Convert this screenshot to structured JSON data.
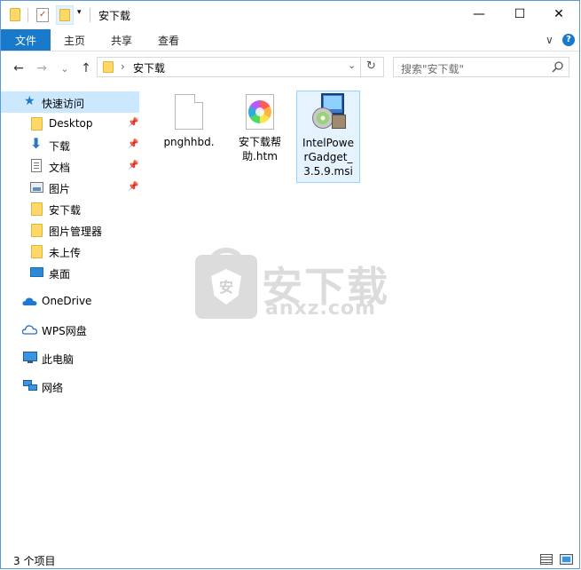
{
  "window": {
    "title": "安下载",
    "minimize": "—",
    "maximize": "☐",
    "close": "✕"
  },
  "ribbon": {
    "file_tab": "文件",
    "tabs": [
      "主页",
      "共享",
      "查看"
    ],
    "expand": "∨",
    "help": "?"
  },
  "nav": {
    "back": "←",
    "forward": "→",
    "recent": "⌄",
    "up": "↑"
  },
  "address": {
    "separator": "›",
    "path": "安下载",
    "dropdown": "⌄",
    "refresh": "↻"
  },
  "search": {
    "placeholder": "搜索\"安下载\""
  },
  "sidebar": {
    "quick_access": "快速访问",
    "items": [
      {
        "label": "Desktop",
        "icon": "folder-icon",
        "pinned": true
      },
      {
        "label": "下载",
        "icon": "download-icon",
        "pinned": true
      },
      {
        "label": "文档",
        "icon": "document-icon",
        "pinned": true
      },
      {
        "label": "图片",
        "icon": "picture-icon",
        "pinned": true
      },
      {
        "label": "安下载",
        "icon": "folder-icon",
        "pinned": false
      },
      {
        "label": "图片管理器",
        "icon": "folder-icon",
        "pinned": false
      },
      {
        "label": "未上传",
        "icon": "folder-icon",
        "pinned": false
      },
      {
        "label": "桌面",
        "icon": "desktop-icon",
        "pinned": false
      }
    ],
    "onedrive": "OneDrive",
    "wps": "WPS网盘",
    "this_pc": "此电脑",
    "network": "网络"
  },
  "files": [
    {
      "name": "pnghhbd.",
      "icon": "blank-file-icon"
    },
    {
      "name": "安下载帮助.htm",
      "icon": "htm-file-icon"
    },
    {
      "name": "IntelPowerGadget_3.5.9.msi",
      "icon": "msi-installer-icon"
    }
  ],
  "watermark": {
    "brand": "安下载",
    "domain": "anxz.com",
    "badge": "安"
  },
  "status": {
    "count": "3 个项目"
  },
  "colors": {
    "accent": "#1979ca",
    "selection": "#cce8ff"
  }
}
